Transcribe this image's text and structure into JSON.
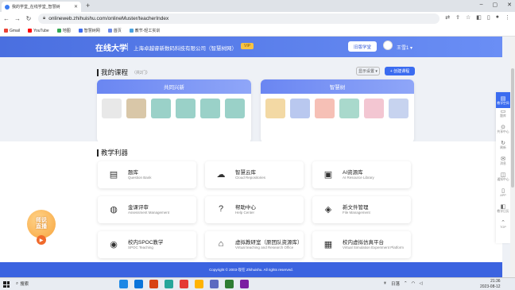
{
  "browser": {
    "tab_title": "我的学堂_在线学堂_智慧树",
    "new_tab": "+",
    "url": "onlineweb.zhihuishu.com/onlineMuster/teacherIndex",
    "bookmarks": [
      {
        "label": "Gmail",
        "color": "#ea4335"
      },
      {
        "label": "YouTube",
        "color": "#ff0000"
      },
      {
        "label": "地图",
        "color": "#34a853"
      },
      {
        "label": "智慧树网",
        "color": "#3b6cf0"
      },
      {
        "label": "首页",
        "color": "#6b8ae8"
      },
      {
        "label": "教节-轻工实训",
        "color": "#4aa3df"
      }
    ]
  },
  "header": {
    "logo": "在线大学",
    "company": "上海卓越睿新数码科技有限公司（智慧树网）",
    "vip": "VIP",
    "student_button": "旧版学堂",
    "username": "王雪1"
  },
  "courses": {
    "title": "我的课程",
    "count": "（共2门）",
    "sort_label": "显示设置",
    "create_label": "+ 创建课程",
    "cards": [
      {
        "name": "共同兴新",
        "thumb_colors": [
          "#e8e8e8",
          "#d9c7a8",
          "#9ad1c8",
          "#9ad1c8",
          "#9ad1c8",
          "#9ad1c8"
        ]
      },
      {
        "name": "智慧树",
        "thumb_colors": [
          "#f3d9a4",
          "#b9c8ef",
          "#f6c0b6",
          "#a9d9cc",
          "#f3c6d2",
          "#c7d3ef"
        ]
      }
    ]
  },
  "tools": {
    "title": "教学利器",
    "items": [
      {
        "name": "题库",
        "sub": "Question Bank",
        "icon": "question-bank-icon",
        "glyph": "▤"
      },
      {
        "name": "智慧云库",
        "sub": "Cloud Repositories",
        "icon": "cloud-icon",
        "glyph": "☁"
      },
      {
        "name": "AI资源库",
        "sub": "AI Resource Library",
        "icon": "ai-resource-icon",
        "glyph": "▣"
      },
      {
        "name": "金课评审",
        "sub": "Assessment Management",
        "icon": "assessment-icon",
        "glyph": "◍"
      },
      {
        "name": "帮助中心",
        "sub": "Help Center",
        "icon": "help-icon",
        "glyph": "?"
      },
      {
        "name": "新文件管理",
        "sub": "File Management",
        "icon": "file-icon",
        "glyph": "◈"
      },
      {
        "name": "校内SPOC教学",
        "sub": "SPOC Teaching",
        "icon": "spoc-icon",
        "glyph": "◉"
      },
      {
        "name": "虚拟教研室（原团队资源库）",
        "sub": "Virtual teaching and Research Office",
        "icon": "virtual-office-icon",
        "glyph": "⌂"
      },
      {
        "name": "校内虚拟仿真平台",
        "sub": "Virtual Simulation Experiment Platform",
        "icon": "simulation-icon",
        "glyph": "▦"
      }
    ]
  },
  "footer": "Copyright © 2003-现在 Zhihuishu. All rights reserved.",
  "sidebar": [
    {
      "label": "教学空间",
      "glyph": "▤"
    },
    {
      "label": "题库",
      "glyph": "▭"
    },
    {
      "label": "共享中心",
      "glyph": "⊙"
    },
    {
      "label": "刷新",
      "glyph": "↻"
    },
    {
      "label": "消息",
      "glyph": "✉"
    },
    {
      "label": "通知中心",
      "glyph": "◫"
    },
    {
      "label": "APP",
      "glyph": "▯"
    },
    {
      "label": "教学日历",
      "glyph": "◧"
    },
    {
      "label": "TOP",
      "glyph": "⌃"
    }
  ],
  "live": {
    "line1": "师说",
    "line2": "直播"
  },
  "taskbar": {
    "search": "搜索",
    "tray_label": "日落",
    "time": "21:36",
    "date": "2023-08-12",
    "apps": [
      "#1e88e5",
      "#0a74da",
      "#d84315",
      "#26a69a",
      "#e53935",
      "#ffb300",
      "#5c6bc0",
      "#2e7d32",
      "#7b1fa2"
    ]
  }
}
